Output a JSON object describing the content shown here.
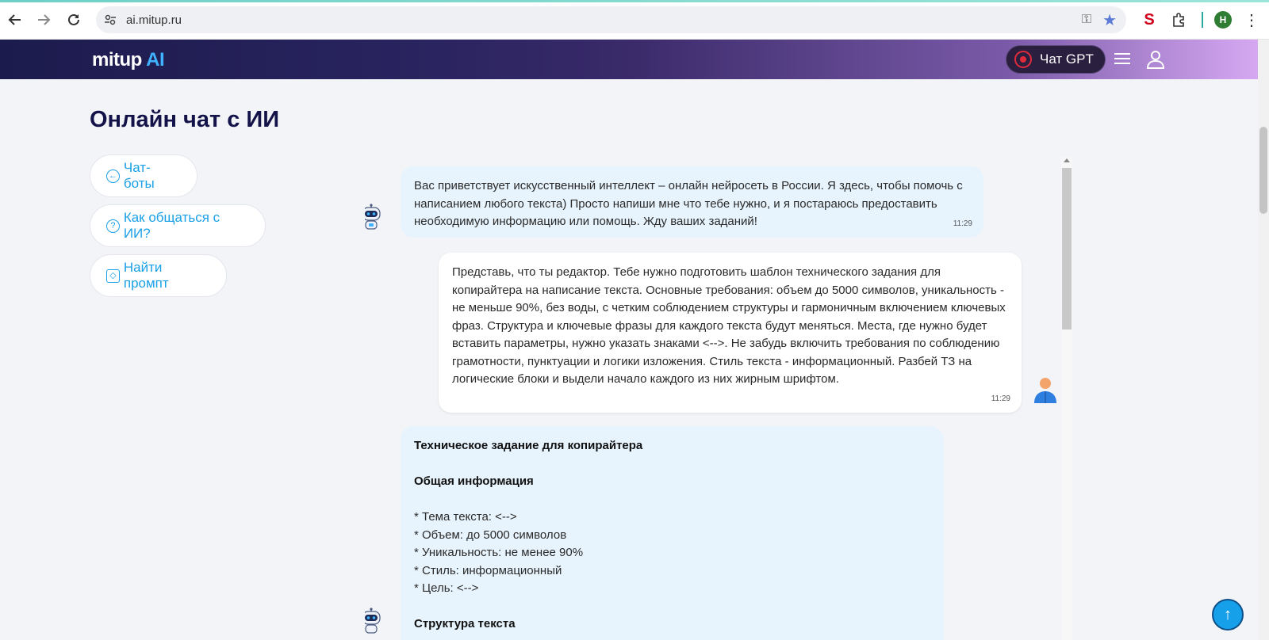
{
  "browser": {
    "url": "ai.mitup.ru",
    "profile_initial": "H"
  },
  "header": {
    "logo_main": "mitup",
    "logo_ai": "AI",
    "chat_gpt_label": "Чат GPT"
  },
  "page": {
    "title": "Онлайн чат с ИИ"
  },
  "sidebar": {
    "buttons": [
      {
        "label": "Чат-боты",
        "icon": "arrow-left-circle-icon"
      },
      {
        "label": "Как общаться с ИИ?",
        "icon": "question-circle-icon"
      },
      {
        "label": "Найти промпт",
        "icon": "cube-icon"
      }
    ]
  },
  "chat": {
    "messages": [
      {
        "role": "ai",
        "text": "Вас приветствует искусственный интеллект – онлайн нейросеть в России. Я здесь, чтобы помочь с написанием любого текста) Просто напиши мне что тебе нужно, и я постараюсь предоставить необходимую информацию или помощь. Жду ваших заданий!",
        "time": "11:29"
      },
      {
        "role": "user",
        "text": "Представь, что ты редактор. Тебе нужно подготовить шаблон технического задания для копирайтера на написание текста. Основные требования: объем до 5000 символов, уникальность - не меньше 90%, без воды, с четким соблюдением структуры и гармоничным включением ключевых фраз. Структура и ключевые фразы для каждого текста будут меняться. Места, где нужно будет вставить параметры, нужно указать знаками <-->. Не забудь включить требования по соблюдению грамотности, пунктуации и логики изложения. Стиль текста - информационный. Разбей ТЗ на логические блоки и выдели начало каждого из них жирным шрифтом.",
        "time": "11:29"
      },
      {
        "role": "ai",
        "lines": [
          {
            "text": "Техническое задание для копирайтера",
            "bold": true
          },
          {
            "text": "",
            "bold": false
          },
          {
            "text": "Общая информация",
            "bold": true
          },
          {
            "text": "",
            "bold": false
          },
          {
            "text": "* Тема текста: <-->",
            "bold": false
          },
          {
            "text": "* Объем: до 5000 символов",
            "bold": false
          },
          {
            "text": "* Уникальность: не менее 90%",
            "bold": false
          },
          {
            "text": "* Стиль: информационный",
            "bold": false
          },
          {
            "text": "* Цель: <-->",
            "bold": false
          },
          {
            "text": "",
            "bold": false
          },
          {
            "text": "Структура текста",
            "bold": true
          }
        ]
      }
    ]
  },
  "colors": {
    "accent": "#1aa0e6",
    "title": "#13134a",
    "ai_bubble": "#e8f4fd",
    "user_bubble": "#ffffff"
  }
}
